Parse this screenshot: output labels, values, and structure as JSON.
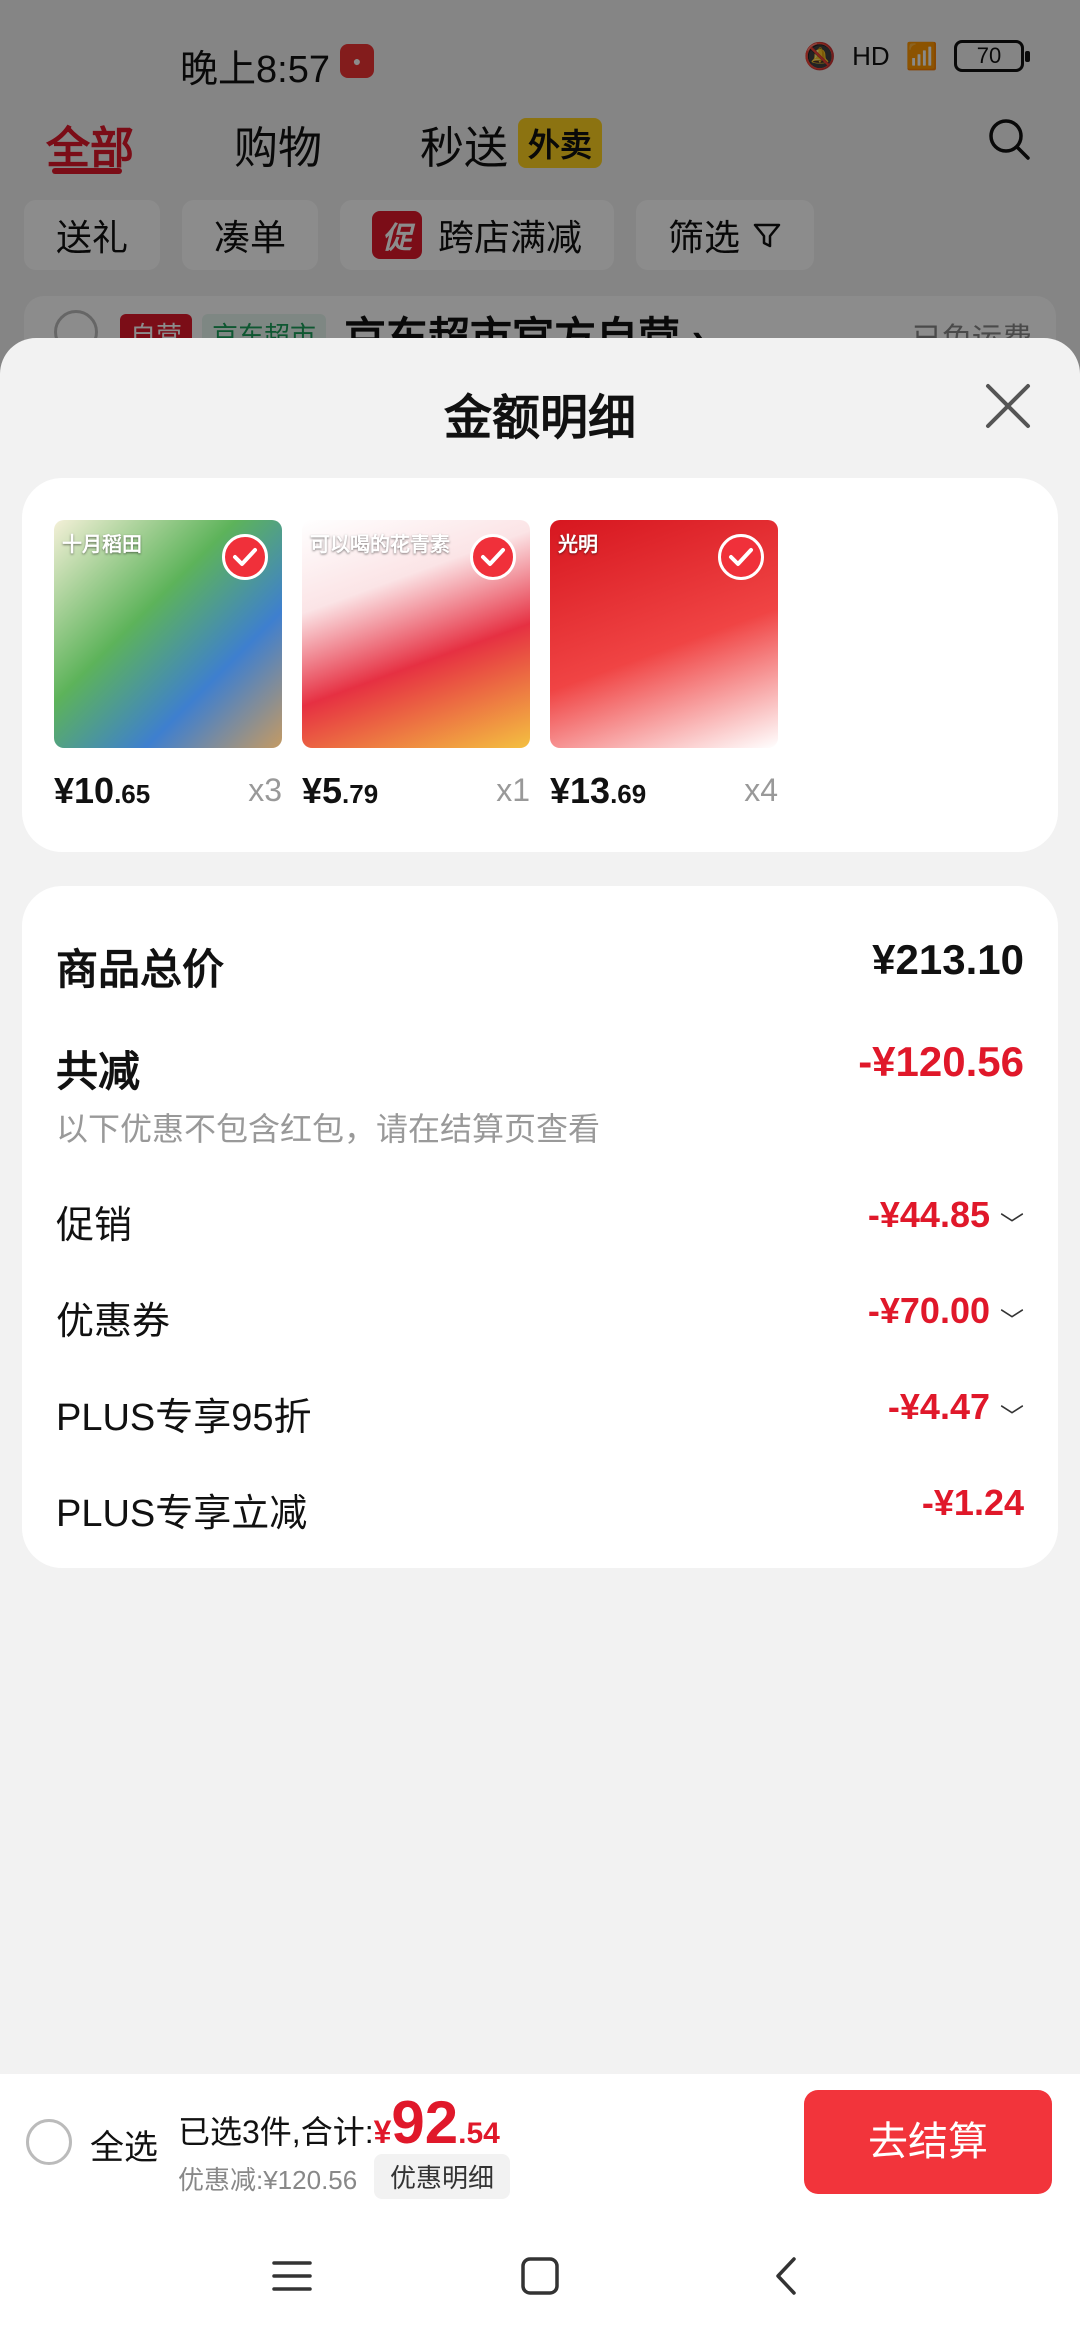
{
  "status_bar": {
    "time": "晚上8:57",
    "battery": "70",
    "network": "HD"
  },
  "background": {
    "tabs": [
      "全部",
      "购物",
      "秒送"
    ],
    "takeout_badge": "外卖",
    "filters": [
      "送礼",
      "凑单",
      "跨店满减",
      "筛选"
    ],
    "promo_tag": "促",
    "store": {
      "self_tag": "自营",
      "market_tag": "京东超市",
      "name": "京东超市官方自营 ›",
      "shipping": "已免运费"
    }
  },
  "sheet": {
    "title": "金额明细",
    "products": [
      {
        "label": "十月稻田",
        "price_int": "¥10",
        "price_dec": ".65",
        "qty": "x3"
      },
      {
        "label": "可以喝的花青素",
        "price_int": "¥5",
        "price_dec": ".79",
        "qty": "x1"
      },
      {
        "label": "光明",
        "price_int": "¥13",
        "price_dec": ".69",
        "qty": "x4"
      }
    ],
    "details": {
      "total_label": "商品总价",
      "total_value": "¥213.10",
      "reduce_label": "共减",
      "reduce_value": "-¥120.56",
      "note": "以下优惠不包含红包，请在结算页查看",
      "items": [
        {
          "label": "促销",
          "value": "-¥44.85",
          "expandable": true
        },
        {
          "label": "优惠券",
          "value": "-¥70.00",
          "expandable": true
        },
        {
          "label": "PLUS专享95折",
          "value": "-¥4.47",
          "expandable": true
        },
        {
          "label": "PLUS专享立减",
          "value": "-¥1.24",
          "expandable": false
        }
      ]
    }
  },
  "checkout": {
    "select_all": "全选",
    "selected_text": "已选3件,合计:",
    "currency": "¥",
    "total_int": "92",
    "total_dec": ".54",
    "discount_text": "优惠减:¥120.56",
    "detail_button": "优惠明细",
    "checkout_button": "去结算"
  },
  "colors": {
    "accent": "#e0182a",
    "button": "#f2343b"
  }
}
